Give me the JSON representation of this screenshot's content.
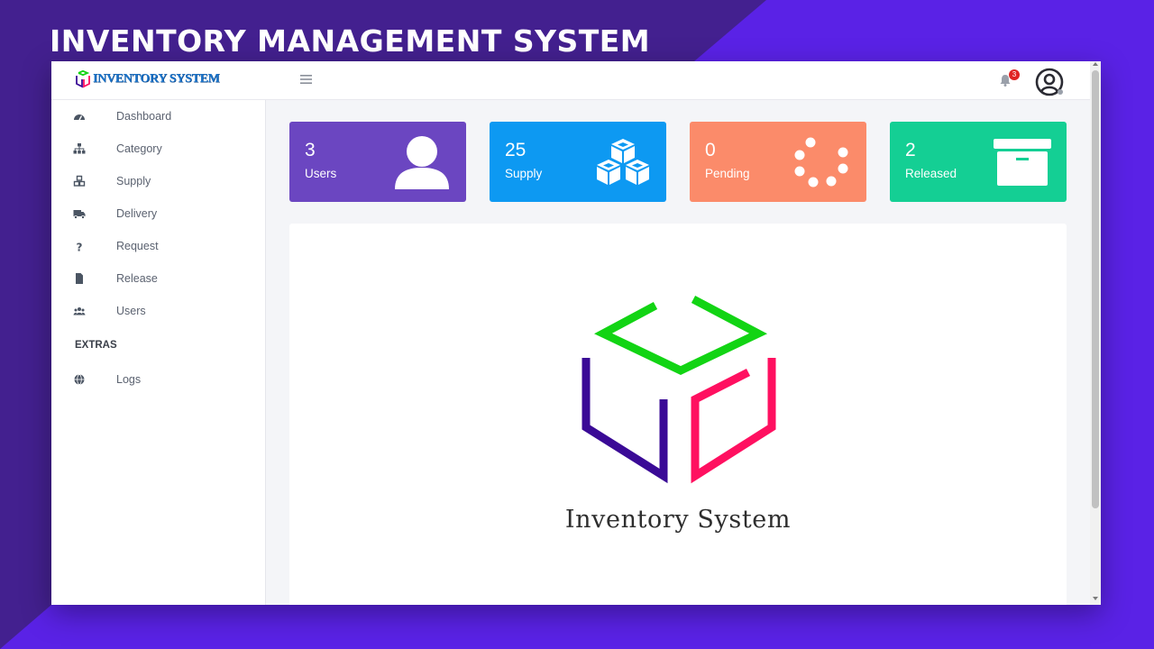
{
  "banner": {
    "title": "INVENTORY MANAGEMENT SYSTEM"
  },
  "header": {
    "logo_text": "INVENTORY SYSTEM",
    "menu_icon": "hamburger-icon",
    "notification_icon": "bell-icon",
    "notification_count": "3",
    "profile_icon": "user-circle-icon"
  },
  "sidebar": {
    "items": [
      {
        "label": "Dashboard",
        "icon": "tachometer-icon"
      },
      {
        "label": "Category",
        "icon": "sitemap-icon"
      },
      {
        "label": "Supply",
        "icon": "cubes-icon"
      },
      {
        "label": "Delivery",
        "icon": "truck-icon"
      },
      {
        "label": "Request",
        "icon": "question-icon"
      },
      {
        "label": "Release",
        "icon": "file-icon"
      },
      {
        "label": "Users",
        "icon": "users-icon"
      }
    ],
    "section_heading": "EXTRAS",
    "extras": [
      {
        "label": "Logs",
        "icon": "globe-icon"
      }
    ]
  },
  "cards": [
    {
      "value": "3",
      "label": "Users",
      "color": "#6b46c1",
      "icon": "user-icon"
    },
    {
      "value": "25",
      "label": "Supply",
      "color": "#0d99f2",
      "icon": "cubes-icon"
    },
    {
      "value": "0",
      "label": "Pending",
      "color": "#fb8b6a",
      "icon": "spinner-icon"
    },
    {
      "value": "2",
      "label": "Released",
      "color": "#14cf94",
      "icon": "archive-icon"
    }
  ],
  "panel": {
    "caption": "Inventory System"
  },
  "colors": {
    "background": "#5a22e6",
    "background_dark": "#43208f",
    "logo_green": "#12d414",
    "logo_purple": "#3a0a96",
    "logo_pink": "#ff1060"
  }
}
